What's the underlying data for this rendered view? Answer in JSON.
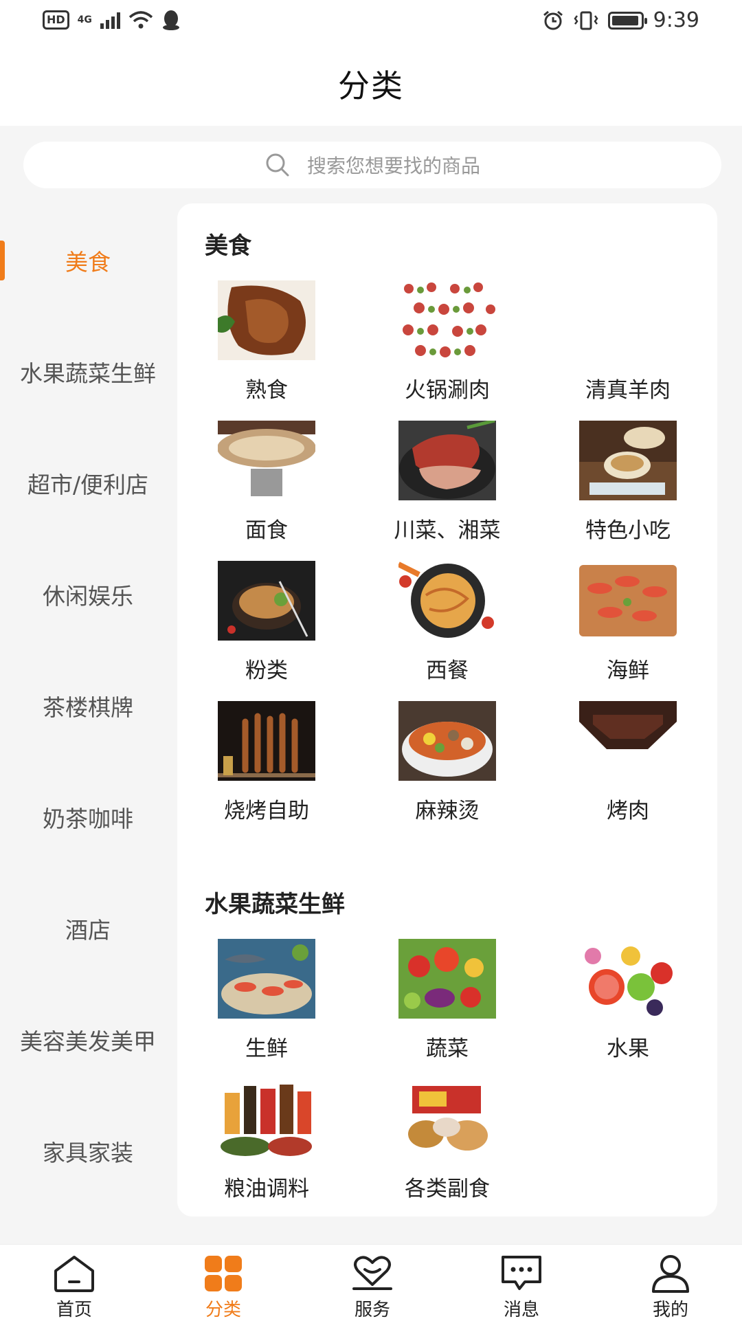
{
  "status_bar": {
    "hd": "HD",
    "network": "4G",
    "time": "9:39"
  },
  "header": {
    "title": "分类"
  },
  "search": {
    "placeholder": "搜索您想要找的商品"
  },
  "sidebar": {
    "items": [
      {
        "label": "美食",
        "active": true
      },
      {
        "label": "水果蔬菜生鲜"
      },
      {
        "label": "超市/便利店"
      },
      {
        "label": "休闲娱乐"
      },
      {
        "label": "茶楼棋牌"
      },
      {
        "label": "奶茶咖啡"
      },
      {
        "label": "酒店"
      },
      {
        "label": "美容美发美甲"
      },
      {
        "label": "家具家装"
      }
    ]
  },
  "sections": [
    {
      "title": "美食",
      "items": [
        {
          "label": "熟食",
          "image": "braised-meat"
        },
        {
          "label": "火锅涮肉",
          "image": "hotpot-dishes"
        },
        {
          "label": "清真羊肉",
          "image": "none"
        },
        {
          "label": "面食",
          "image": "noodles"
        },
        {
          "label": "川菜、湘菜",
          "image": "cured-meat"
        },
        {
          "label": "特色小吃",
          "image": "snacks"
        },
        {
          "label": "粉类",
          "image": "rice-noodles"
        },
        {
          "label": "西餐",
          "image": "spaghetti"
        },
        {
          "label": "海鲜",
          "image": "seafood-platter"
        },
        {
          "label": "烧烤自助",
          "image": "skewers"
        },
        {
          "label": "麻辣烫",
          "image": "malatang"
        },
        {
          "label": "烤肉",
          "image": "bbq"
        }
      ]
    },
    {
      "title": "水果蔬菜生鲜",
      "items": [
        {
          "label": "生鲜",
          "image": "fresh-seafood"
        },
        {
          "label": "蔬菜",
          "image": "vegetables"
        },
        {
          "label": "水果",
          "image": "fruits"
        },
        {
          "label": "粮油调料",
          "image": "oil-seasoning"
        },
        {
          "label": "各类副食",
          "image": "groceries"
        }
      ]
    }
  ],
  "tabbar": {
    "items": [
      {
        "label": "首页",
        "icon": "home-icon"
      },
      {
        "label": "分类",
        "icon": "category-icon",
        "active": true
      },
      {
        "label": "服务",
        "icon": "service-icon"
      },
      {
        "label": "消息",
        "icon": "message-icon"
      },
      {
        "label": "我的",
        "icon": "profile-icon"
      }
    ]
  },
  "colors": {
    "accent": "#f07c1a",
    "background": "#f5f5f5"
  }
}
